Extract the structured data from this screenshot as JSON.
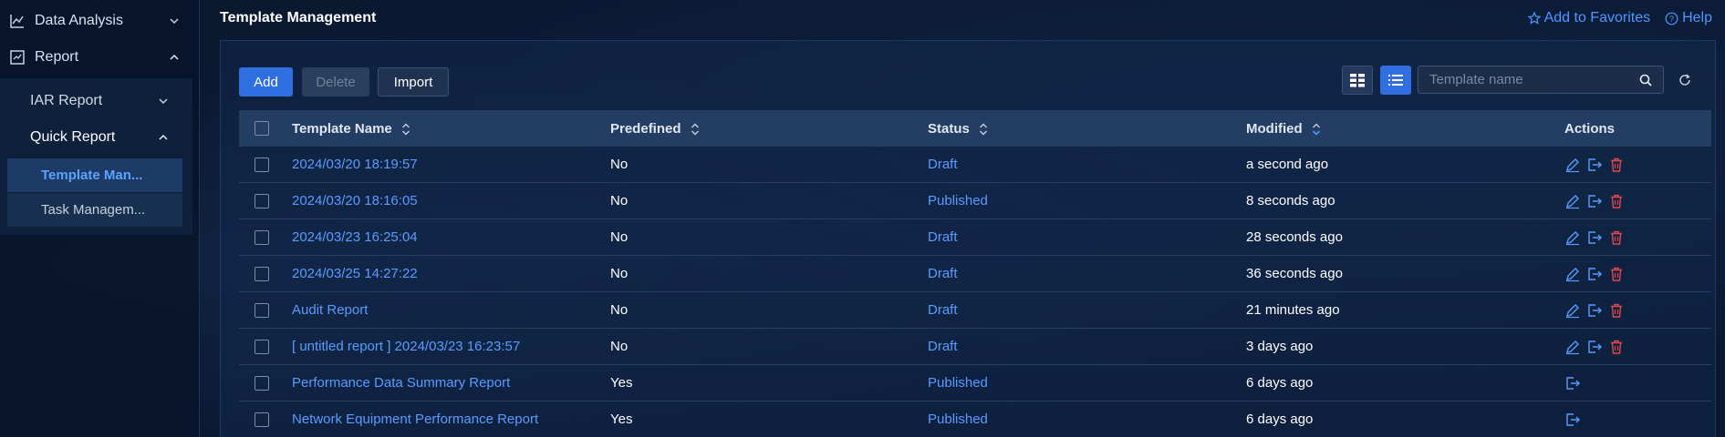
{
  "sidebar": {
    "data_analysis": "Data Analysis",
    "report": "Report",
    "iar_report": "IAR Report",
    "quick_report": "Quick Report",
    "template_management": "Template Man...",
    "task_management": "Task Managem..."
  },
  "header": {
    "title": "Template Management",
    "add_favorites": "Add to Favorites",
    "help": "Help"
  },
  "toolbar": {
    "add": "Add",
    "delete": "Delete",
    "import": "Import",
    "search_placeholder": "Template name"
  },
  "table": {
    "columns": [
      "Template Name",
      "Predefined",
      "Status",
      "Modified",
      "Actions"
    ],
    "rows": [
      {
        "name": "2024/03/20 18:19:57",
        "predefined": "No",
        "status": "Draft",
        "modified": "a second ago",
        "editable": true
      },
      {
        "name": "2024/03/20 18:16:05",
        "predefined": "No",
        "status": "Published",
        "modified": "8 seconds ago",
        "editable": true
      },
      {
        "name": "2024/03/23 16:25:04",
        "predefined": "No",
        "status": "Draft",
        "modified": "28 seconds ago",
        "editable": true
      },
      {
        "name": "2024/03/25 14:27:22",
        "predefined": "No",
        "status": "Draft",
        "modified": "36 seconds ago",
        "editable": true
      },
      {
        "name": "Audit Report",
        "predefined": "No",
        "status": "Draft",
        "modified": "21 minutes ago",
        "editable": true
      },
      {
        "name": "[ untitled report ] 2024/03/23 16:23:57",
        "predefined": "No",
        "status": "Draft",
        "modified": "3 days ago",
        "editable": true
      },
      {
        "name": "Performance Data Summary Report",
        "predefined": "Yes",
        "status": "Published",
        "modified": "6 days ago",
        "editable": false
      },
      {
        "name": "Network Equipment Performance Report",
        "predefined": "Yes",
        "status": "Published",
        "modified": "6 days ago",
        "editable": false
      }
    ]
  },
  "colors": {
    "accent": "#2f6fe0",
    "link": "#5b9bff",
    "delete_icon": "#e04848"
  }
}
